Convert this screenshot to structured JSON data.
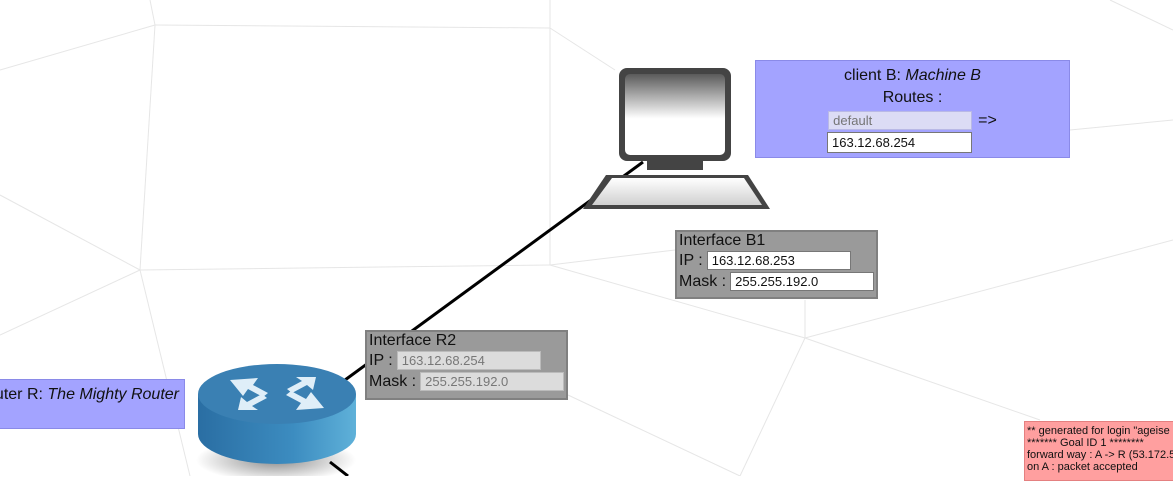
{
  "client": {
    "label": "client B: ",
    "name": "Machine B",
    "routes_label": "Routes :",
    "route_dest_placeholder": "default",
    "arrow": "=>",
    "route_gateway": "163.12.68.254"
  },
  "interface_b1": {
    "title": "Interface B1",
    "ip_label": "IP :",
    "ip": "163.12.68.253",
    "mask_label": "Mask :",
    "mask": "255.255.192.0"
  },
  "interface_r2": {
    "title": "Interface R2",
    "ip_label": "IP :",
    "ip": "163.12.68.254",
    "mask_label": "Mask :",
    "mask": "255.255.192.0"
  },
  "router": {
    "label": "outer R: ",
    "name": "The Mighty Router"
  },
  "log": {
    "lines": [
      "** generated for login \"ageise",
      "******* Goal ID 1 ********",
      "forward way : A -> R (53.172.5",
      "on A : packet accepted"
    ]
  },
  "colors": {
    "client_panel": "#a3a3ff",
    "interface_panel": "#9a9a9a",
    "log_panel": "#ff9f9f",
    "router_body": "#3c86b8"
  }
}
